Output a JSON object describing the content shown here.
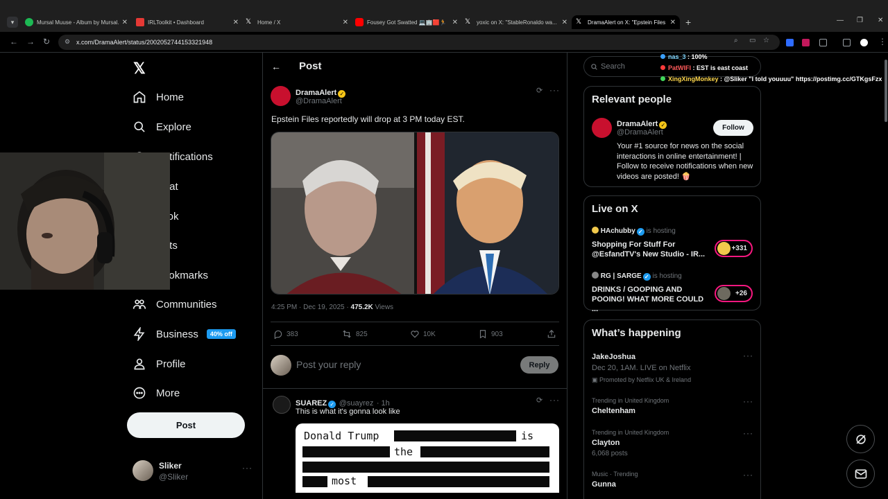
{
  "browser": {
    "tabs": [
      {
        "title": "Mursal Muuse - Album by Mursal...",
        "favicon_color": "#1db954"
      },
      {
        "title": "IRLToolkit • Dashboard",
        "favicon_color": "#e53935"
      },
      {
        "title": "Home / X",
        "favicon_color": "#ffffff"
      },
      {
        "title": "Fousey Got Swatted 💻🏢🟥🏃",
        "favicon_color": "#ff0000"
      },
      {
        "title": "yoxic on X: \"StableRonaldo wa...",
        "favicon_color": "#ffffff"
      },
      {
        "title": "DramaAlert on X: \"Epstein Files...",
        "favicon_color": "#ffffff"
      }
    ],
    "url": "x.com/DramaAlert/status/2002052744153321948"
  },
  "nav": {
    "items": [
      {
        "label": "Home",
        "icon": "home-icon"
      },
      {
        "label": "Explore",
        "icon": "search-icon"
      },
      {
        "label": "Notifications",
        "icon": "bell-icon"
      },
      {
        "label": "Chat",
        "icon": "chat-icon"
      },
      {
        "label": "Grok",
        "icon": "grok-icon"
      },
      {
        "label": "Lists",
        "icon": "list-icon"
      },
      {
        "label": "Bookmarks",
        "icon": "bookmark-icon"
      },
      {
        "label": "Communities",
        "icon": "communities-icon"
      },
      {
        "label": "Business",
        "icon": "lightning-icon"
      },
      {
        "label": "Profile",
        "icon": "person-icon"
      },
      {
        "label": "More",
        "icon": "more-circle-icon"
      }
    ],
    "business_badge": "40% off",
    "post_label": "Post",
    "account": {
      "name": "Sliker",
      "handle": "@Sliker"
    }
  },
  "header": {
    "title": "Post"
  },
  "post": {
    "author": "DramaAlert",
    "handle": "@DramaAlert",
    "text": "Epstein Files reportedly will drop at 3 PM today EST.",
    "time": "4:25 PM · Dec 19, 2025 · ",
    "views": "475.2K",
    "views_label": " Views",
    "replies": "383",
    "reposts": "825",
    "likes": "10K",
    "bookmarks": "903"
  },
  "reply_box": {
    "placeholder": "Post your reply",
    "button": "Reply"
  },
  "reply": {
    "author": "SUAREZ",
    "handle": "@suayrez",
    "age": "· 1h",
    "text": "This is what it's gonna look like",
    "image_words": [
      "Donald Trump",
      "is",
      "the",
      "most"
    ]
  },
  "sidebar": {
    "search_placeholder": "Search",
    "relevant": {
      "title": "Relevant people",
      "name": "DramaAlert",
      "handle": "@DramaAlert",
      "follow": "Follow",
      "bio": "Your #1 source for news on the social interactions in online entertainment! | Follow to receive notifications when new videos are posted! 🍿"
    },
    "live": {
      "title": "Live on X",
      "items": [
        {
          "host": "HAchubby",
          "status": "is hosting",
          "title": "Shopping For Stuff For @EsfandTV's New Studio - IR...",
          "count": "+331"
        },
        {
          "host": "RG | SARGE",
          "status": "is hosting",
          "title": "DRINKS / GOOPING AND POOING! WHAT MORE COULD ...",
          "count": "+26"
        }
      ]
    },
    "happening": {
      "title": "What’s happening",
      "items": [
        {
          "category": "",
          "name": "JakeJoshua",
          "sub": "Dec 20, 1AM. LIVE on Netflix",
          "promo": "Promoted by Netflix UK & Ireland"
        },
        {
          "category": "Trending in United Kingdom",
          "name": "Cheltenham",
          "sub": ""
        },
        {
          "category": "Trending in United Kingdom",
          "name": "Clayton",
          "sub": "6,068 posts"
        },
        {
          "category": "Music · Trending",
          "name": "Gunna",
          "sub": ""
        }
      ]
    }
  },
  "chat_overlay": [
    {
      "user": "nas_3",
      "msg": " : 100%",
      "color": "#7fd6ff",
      "dot": "#3aa0ff"
    },
    {
      "user": "PatWIFI",
      "msg": " : EST is east coast",
      "color": "#ff5a5a",
      "dot": "#ff3b3b"
    },
    {
      "user": "XingXingMonkey",
      "msg": " : @Sliker \"I told youuuu\" https://postimg.cc/GTKgsFzx",
      "color": "#ffd84d",
      "dot": "#42d65a"
    }
  ]
}
